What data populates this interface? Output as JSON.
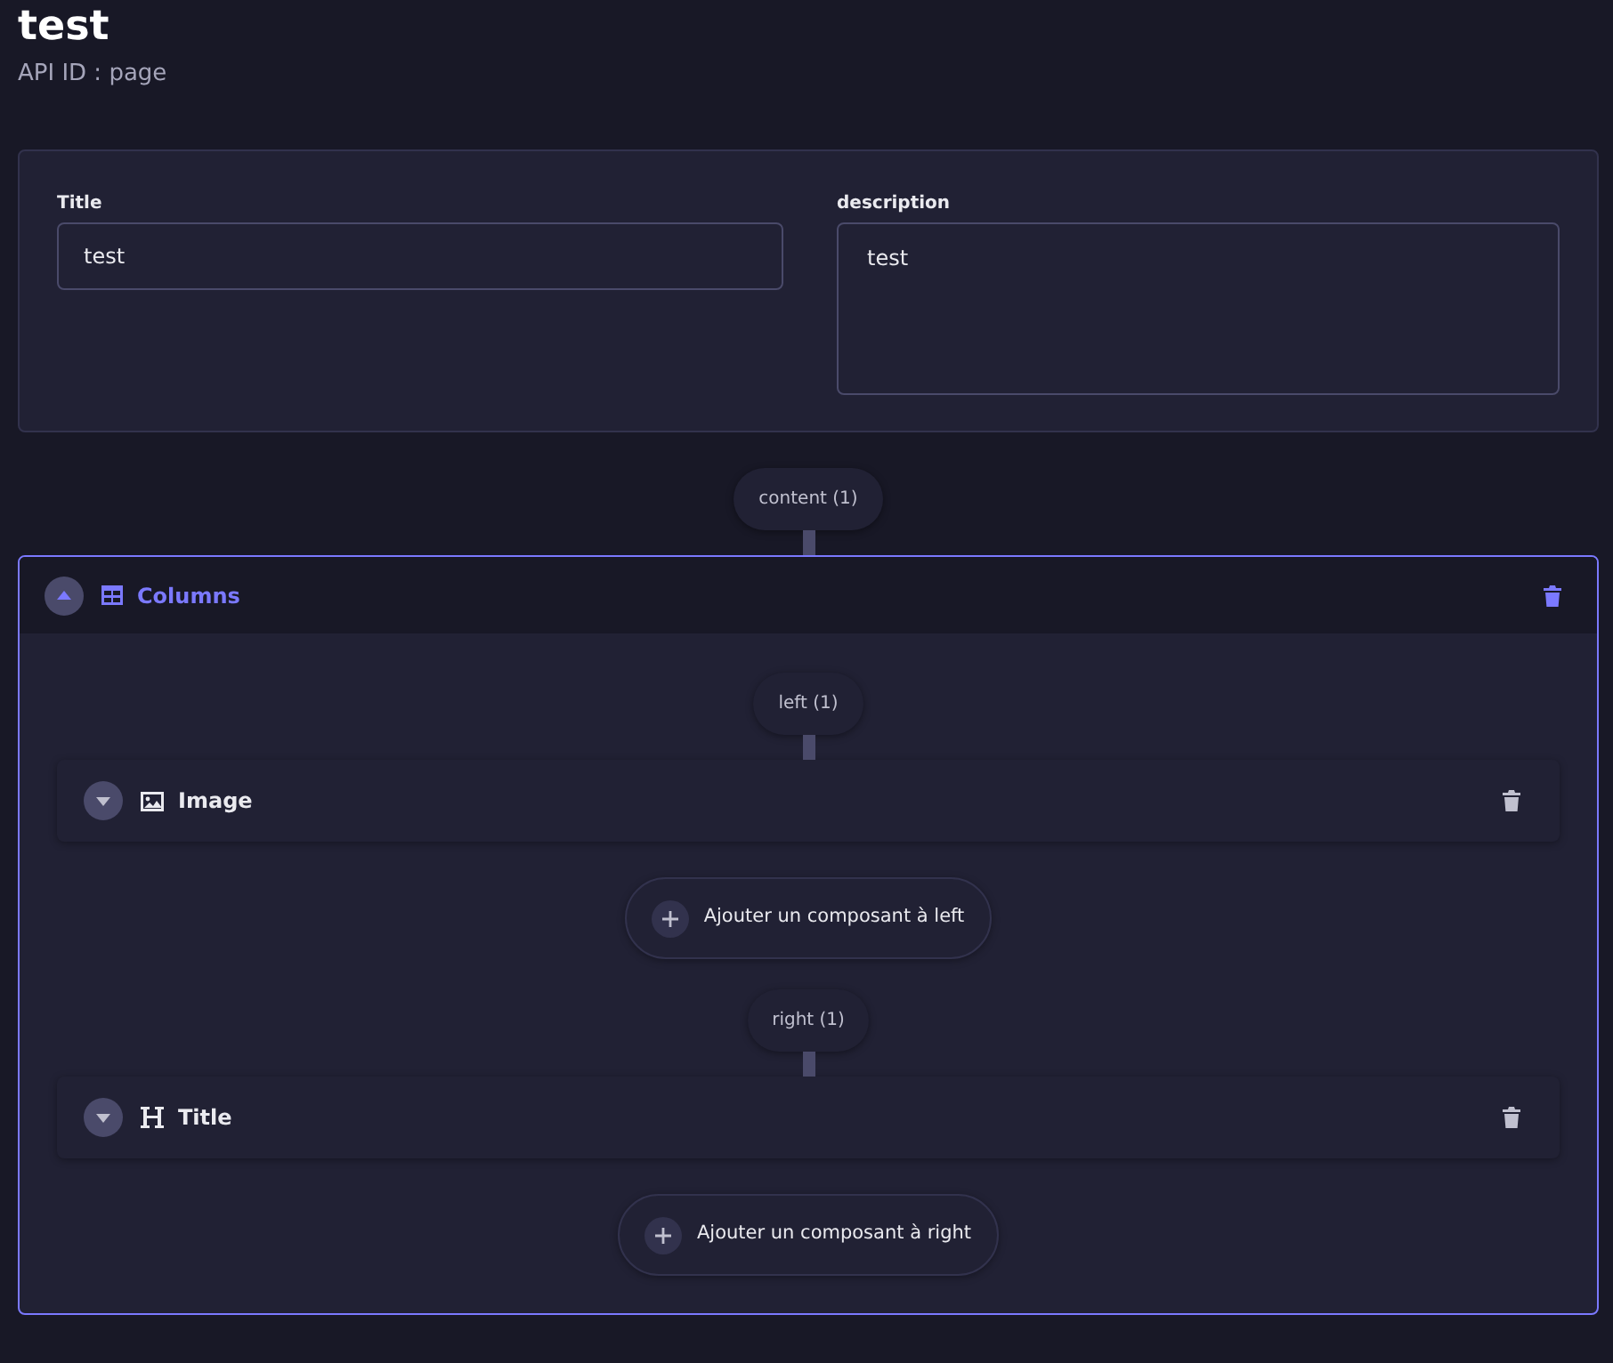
{
  "page": {
    "title": "test",
    "api_id": "API ID : page"
  },
  "fields": [
    {
      "kind": "input",
      "label": "Title",
      "value": "test"
    },
    {
      "kind": "textarea",
      "label": "description",
      "value": "test"
    }
  ],
  "dynamic_zone": {
    "label": "content (1)",
    "components": [
      {
        "kind": "columns",
        "name": "Columns",
        "expanded": true,
        "slots": [
          {
            "label": "left (1)",
            "components": [
              {
                "kind": "image",
                "name": "Image",
                "expanded": false
              }
            ],
            "add_button": "Ajouter un composant à left"
          },
          {
            "label": "right (1)",
            "components": [
              {
                "kind": "heading",
                "name": "Title",
                "expanded": false
              }
            ],
            "add_button": "Ajouter un composant à right"
          }
        ]
      }
    ]
  }
}
